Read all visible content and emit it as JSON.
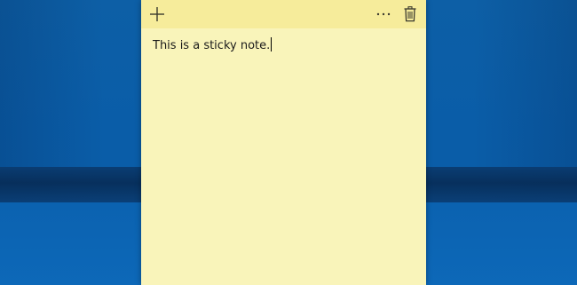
{
  "note": {
    "text": "This is a sticky note.",
    "background_color": "#f9f4ba",
    "toolbar_color": "#f6ec9b"
  },
  "toolbar": {
    "add_icon": "plus-icon",
    "more_icon": "ellipsis-icon",
    "delete_icon": "trash-icon"
  },
  "desktop": {
    "color": "#0a5da8"
  }
}
